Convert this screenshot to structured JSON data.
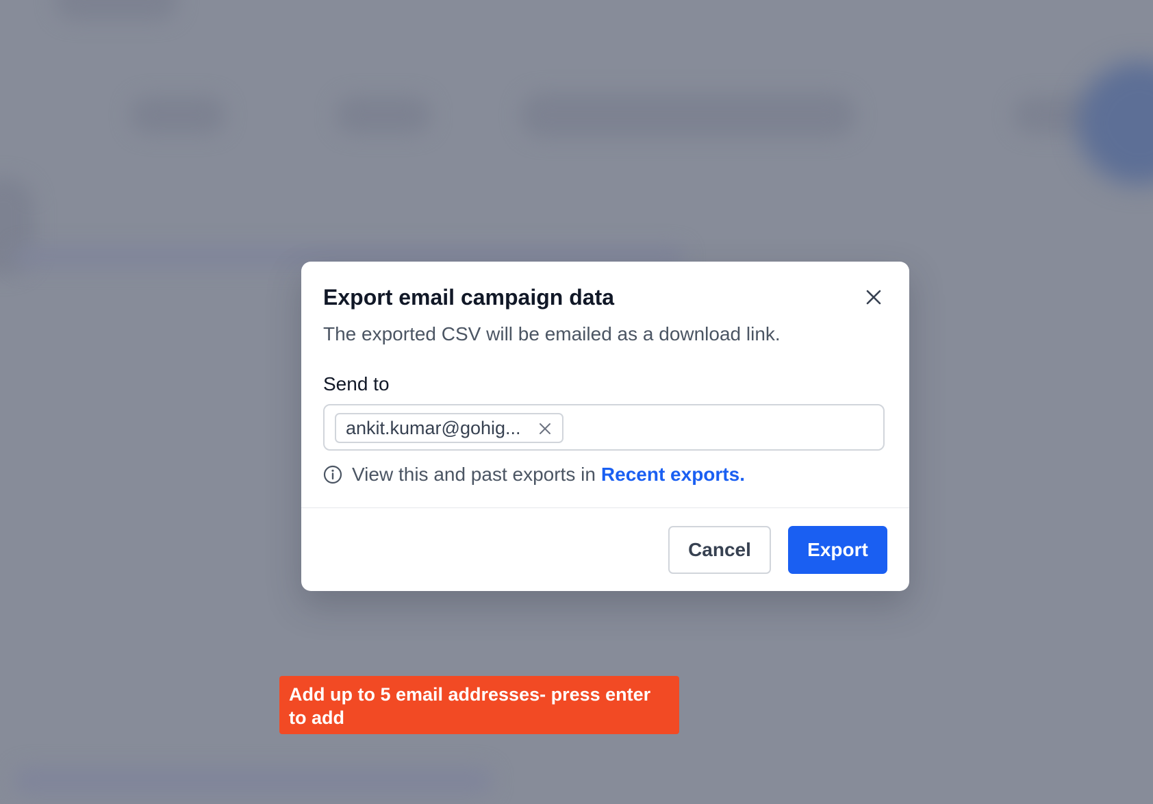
{
  "modal": {
    "title": "Export email campaign data",
    "subtitle": "The exported CSV will be emailed as a download link.",
    "send_to_label": "Send to",
    "recipients": [
      {
        "email": "ankit.kumar@gohig..."
      }
    ],
    "info_text": "View this and past exports in",
    "info_link": "Recent exports.",
    "cancel_label": "Cancel",
    "export_label": "Export"
  },
  "tooltip": {
    "text": "Add up to 5 email addresses- press enter to add"
  },
  "icons": {
    "close": "close-icon",
    "chip_remove": "remove-icon",
    "info": "info-icon"
  },
  "colors": {
    "primary": "#1a5ff2",
    "tooltip_bg": "#f24a24",
    "overlay": "#878c99"
  }
}
